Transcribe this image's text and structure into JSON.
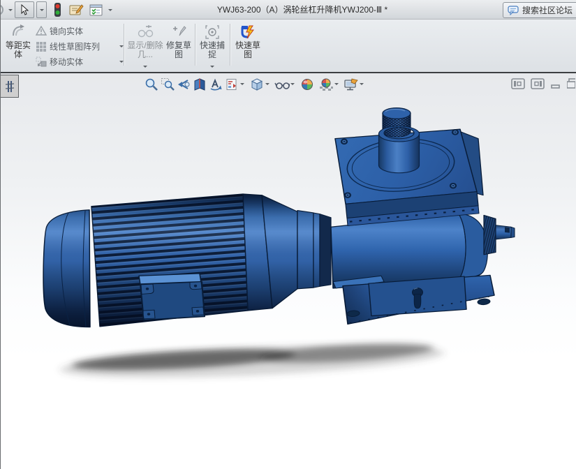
{
  "titlebar": {
    "title": "YWJ63-200（A）涡轮丝杠升降机YWJ200-Ⅲ *",
    "forum_label": "搜索社区论坛"
  },
  "ribbon": {
    "buttons": {
      "offset": "等距实体",
      "mirror": "镜向实体",
      "linear_pattern": "线性草图阵列",
      "move": "移动实体",
      "display_delete": "显示/删除几...",
      "repair_sketch": "修复草图",
      "quick_snaps": "快速捕捉",
      "rapid_sketch": "快速草图"
    }
  },
  "headsup_toolbar": {
    "items": [
      "zoom-to-fit",
      "zoom-to-area",
      "previous-view",
      "section-view",
      "rotate-annotation-view",
      "view-orientation",
      "display-style",
      "hide-show-items",
      "edit-appearance",
      "apply-scene",
      "view-settings"
    ]
  },
  "colors": {
    "model_blue": "#2f63ad",
    "model_highlight": "#4d82c8",
    "model_outline": "#081c38",
    "titlebar_bg": "#d9dcdf",
    "ribbon_bg": "#e3e6e9"
  }
}
